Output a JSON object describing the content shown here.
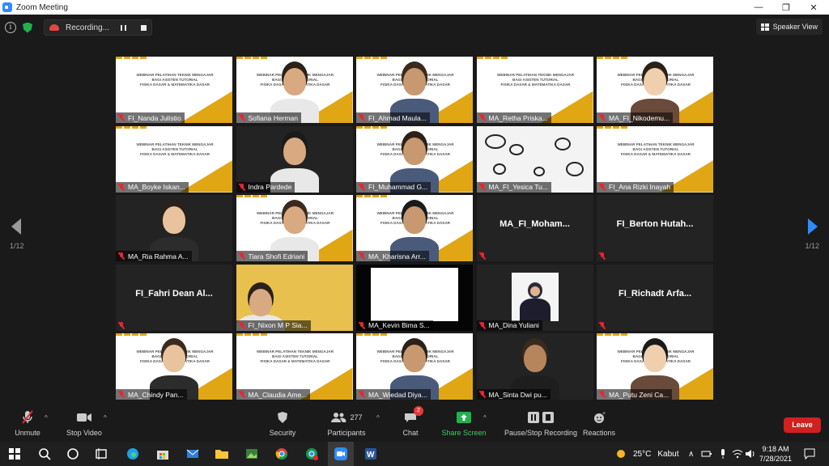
{
  "window": {
    "title": "Zoom Meeting",
    "controls": [
      "—",
      "❐",
      "✕"
    ]
  },
  "meeting": {
    "recording_label": "Recording...",
    "view_button": "Speaker View",
    "page_indicator_left": "1/12",
    "page_indicator_right": "1/12"
  },
  "slide": {
    "line1": "WEBINAR PELATIHAN TEKNIK MENGAJAR",
    "line2": "BAGI ASISTEN TUTORIAL",
    "line3": "FISIKA DASAR & MATEMATIKA DASAR"
  },
  "participants": [
    {
      "name": "FI_Nanda Julistio",
      "kind": "slide"
    },
    {
      "name": "Sofiana Herman",
      "kind": "slide-person"
    },
    {
      "name": "FI_Ahmad Maula...",
      "kind": "slide-person"
    },
    {
      "name": "MA_Retha Priska...",
      "kind": "slide"
    },
    {
      "name": "MA_FI_Nikodemu...",
      "kind": "slide-person"
    },
    {
      "name": "MA_Boyke Iskan...",
      "kind": "slide"
    },
    {
      "name": "Indra Pardede",
      "kind": "person"
    },
    {
      "name": "FI_Muhammad G...",
      "kind": "slide-person"
    },
    {
      "name": "MA_FI_Yesica Tu...",
      "kind": "scribble"
    },
    {
      "name": "FI_Ana Rizki Inayah",
      "kind": "slide"
    },
    {
      "name": "MA_Ria Rahma A...",
      "kind": "person"
    },
    {
      "name": "Tiara Shofi Edriani",
      "kind": "slide-person"
    },
    {
      "name": "MA_Kharisna Arr...",
      "kind": "slide-person"
    },
    {
      "name": "MA_FI_Moham...",
      "kind": "novideo"
    },
    {
      "name": "FI_Berton Hutah...",
      "kind": "novideo"
    },
    {
      "name": "FI_Fahri Dean Al...",
      "kind": "novideo"
    },
    {
      "name": "FI_Nixon M P Sia...",
      "kind": "yellow"
    },
    {
      "name": "MA_Kevin Bima S...",
      "kind": "black"
    },
    {
      "name": "MA_Dina Yuliani",
      "kind": "photo"
    },
    {
      "name": "FI_Richadt Arfa...",
      "kind": "novideo"
    },
    {
      "name": "MA_Chindy Pan...",
      "kind": "slide-person"
    },
    {
      "name": "MA_Claudia Ame...",
      "kind": "slide"
    },
    {
      "name": "MA_Wiedad Diya...",
      "kind": "slide-person"
    },
    {
      "name": "MA_Sinta Dwi pu...",
      "kind": "person"
    },
    {
      "name": "MA_Putu Zeni Ca...",
      "kind": "slide-person"
    }
  ],
  "toolbar": {
    "unmute": "Unmute",
    "stop_video": "Stop Video",
    "security": "Security",
    "participants": "Participants",
    "participants_count": "277",
    "chat": "Chat",
    "chat_badge": "2",
    "share_screen": "Share Screen",
    "pause_stop_recording": "Pause/Stop Recording",
    "reactions": "Reactions",
    "leave": "Leave"
  },
  "taskbar": {
    "weather_temp": "25°C",
    "weather_desc": "Kabut",
    "time": "9:18 AM",
    "date": "7/28/2021"
  },
  "colors": {
    "accent": "#2d8cff",
    "leave": "#d12020",
    "share": "#22b14c",
    "slide_gold": "#e0a614"
  }
}
